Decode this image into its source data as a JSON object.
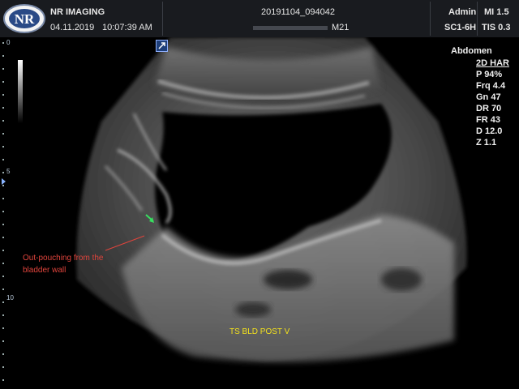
{
  "header": {
    "clinic_name": "NR IMAGING",
    "date": "04.11.2019",
    "time": "10:07:39 AM",
    "study_id": "20191104_094042",
    "patient_suffix": "M21",
    "user": "Admin",
    "mi": "MI 1.5",
    "probe": "SC1-6H",
    "tis": "TIS 0.3"
  },
  "logo": {
    "text": "NR"
  },
  "side_panel": {
    "preset": "Abdomen",
    "mode": "2D HAR",
    "params": [
      "P 94%",
      "Frq 4.4",
      "Gn 47",
      "DR 70",
      "FR 43",
      "D 12.0",
      "Z 1.1"
    ]
  },
  "depth_scale": {
    "labels": [
      "0",
      "5",
      "10"
    ]
  },
  "annotation": {
    "text": "Out-pouching from the bladder wall",
    "color": "#e0443c",
    "arrow_color": "#38e060"
  },
  "scan_caption": {
    "text": "TS BLD POST V",
    "color": "#f4e21c"
  }
}
